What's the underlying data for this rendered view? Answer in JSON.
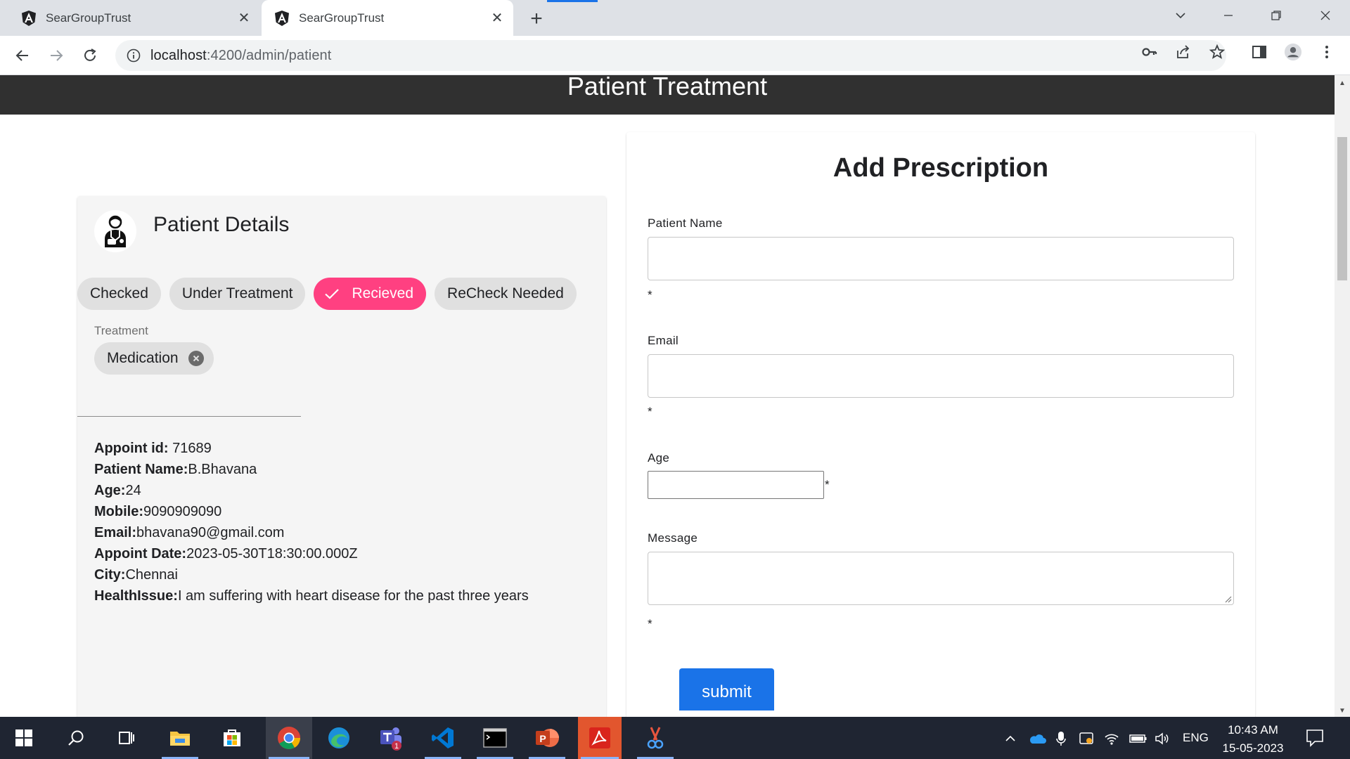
{
  "browser": {
    "tabs": [
      {
        "title": "SearGroupTrust",
        "active": false
      },
      {
        "title": "SearGroupTrust",
        "active": true
      }
    ],
    "new_tab_symbol": "+",
    "close_symbol": "✕",
    "url_host": "localhost",
    "url_path": ":4200/admin/patient",
    "accent_color": "#1a73e8"
  },
  "page": {
    "header_title": "Patient Treatment",
    "header_bg": "#303030"
  },
  "patient_card": {
    "title": "Patient Details",
    "chips": [
      {
        "label": "Checked",
        "selected": false
      },
      {
        "label": "Under Treatment",
        "selected": false
      },
      {
        "label": "Recieved",
        "selected": true
      },
      {
        "label": "ReCheck Needed",
        "selected": false
      }
    ],
    "selected_chip_color": "#ff4081",
    "treatment": {
      "label": "Treatment",
      "chip": "Medication"
    },
    "details": [
      {
        "key": "Appoint id: ",
        "value": "71689"
      },
      {
        "key": "Patient Name:",
        "value": "B.Bhavana"
      },
      {
        "key": "Age:",
        "value": "24"
      },
      {
        "key": "Mobile:",
        "value": "9090909090"
      },
      {
        "key": "Email:",
        "value": "bhavana90@gmail.com"
      },
      {
        "key": "Appoint Date:",
        "value": "2023-05-30T18:30:00.000Z"
      },
      {
        "key": "City:",
        "value": "Chennai"
      },
      {
        "key": "HealthIssue:",
        "value": "I am suffering with heart disease for the past three years"
      }
    ]
  },
  "prescription_form": {
    "title": "Add Prescription",
    "fields": {
      "patient_name": {
        "label": "Patient Name",
        "value": "",
        "required_mark": "*"
      },
      "email": {
        "label": "Email",
        "value": "",
        "required_mark": "*"
      },
      "age": {
        "label": "Age",
        "value": "",
        "required_mark": "*"
      },
      "message": {
        "label": "Message",
        "value": "",
        "required_mark": "*"
      }
    },
    "submit_label": "submit"
  },
  "taskbar": {
    "apps": [
      "start-icon",
      "search-icon",
      "task-view-icon",
      "file-explorer-icon",
      "microsoft-store-icon",
      "chrome-icon",
      "edge-icon",
      "teams-icon",
      "vscode-icon",
      "terminal-icon",
      "powerpoint-icon",
      "acrobat-icon",
      "snipping-tool-icon"
    ],
    "teams_badge": "1",
    "language": "ENG",
    "time": "10:43 AM",
    "date": "15-05-2023"
  }
}
